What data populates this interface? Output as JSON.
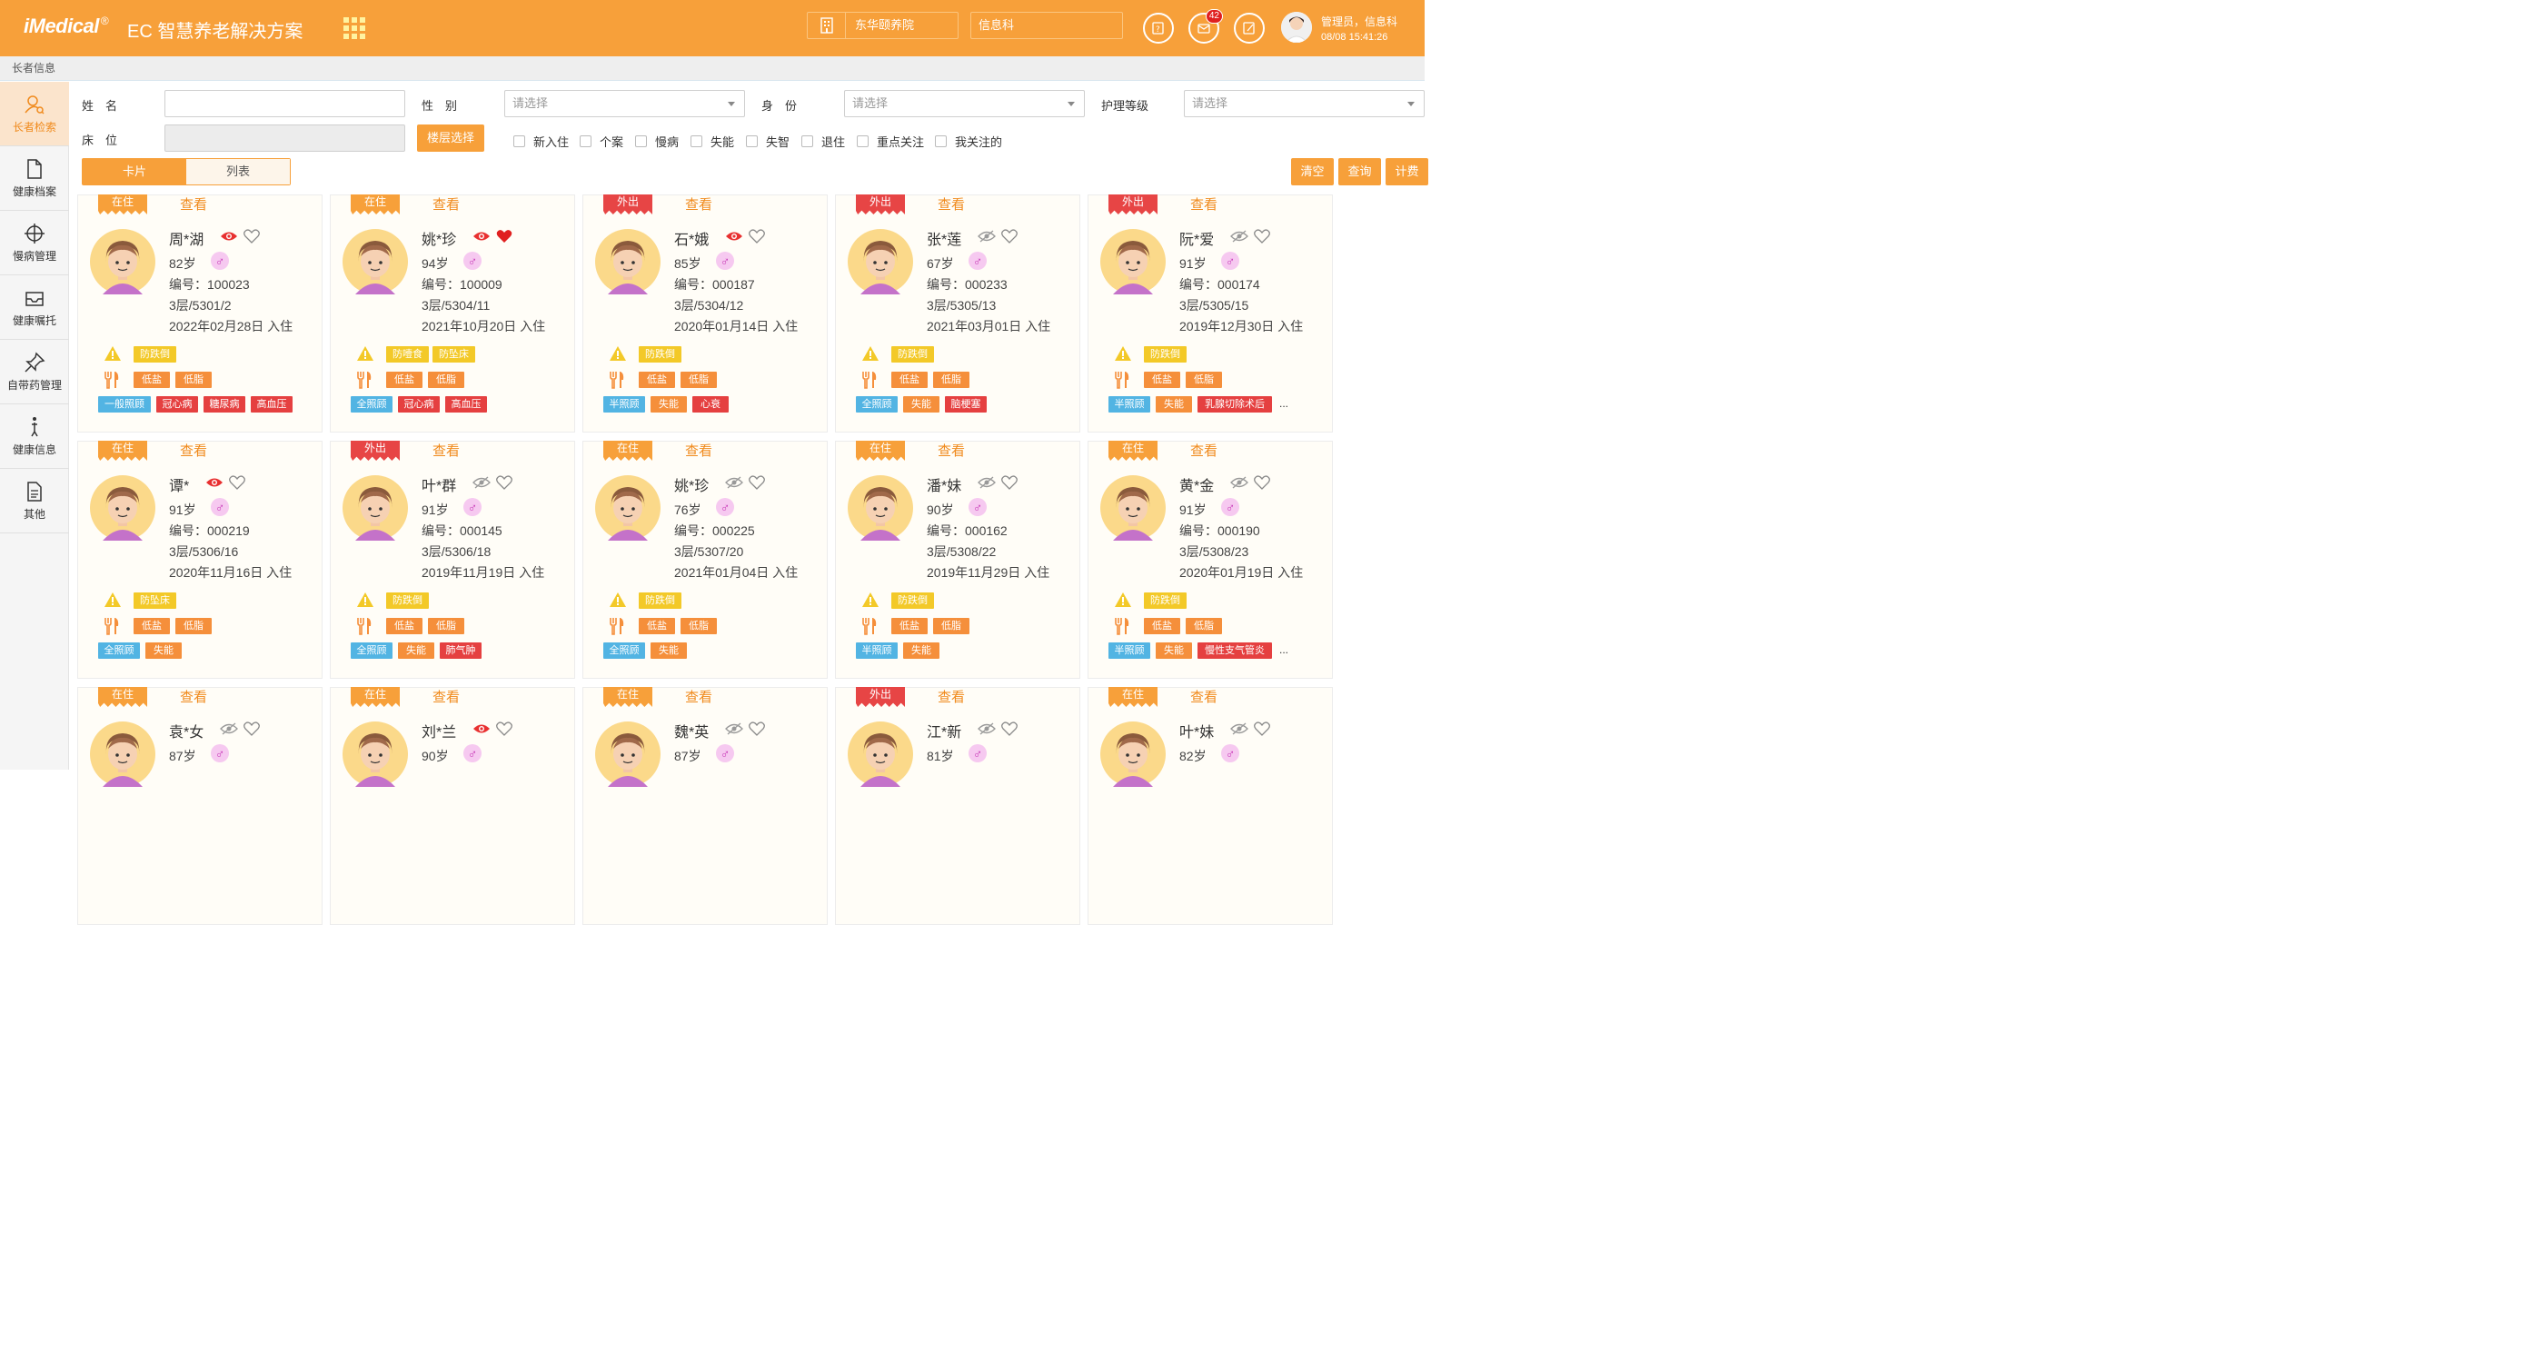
{
  "header": {
    "logo": "iMedical",
    "logo_reg": "®",
    "subtitle": "EC 智慧养老解决方案",
    "org": "东华颐养院",
    "dept": "信息科",
    "badge_count": "42",
    "user": "管理员，信息科",
    "datetime": "08/08 15:41:26"
  },
  "breadcrumb": "长者信息",
  "sidebar": {
    "items": [
      {
        "label": "长者检索",
        "icon": "user-search-icon"
      },
      {
        "label": "健康档案",
        "icon": "document-icon"
      },
      {
        "label": "慢病管理",
        "icon": "crosshair-icon"
      },
      {
        "label": "健康嘱托",
        "icon": "inbox-icon"
      },
      {
        "label": "自带药管理",
        "icon": "pin-icon"
      },
      {
        "label": "健康信息",
        "icon": "info-figure-icon"
      },
      {
        "label": "其他",
        "icon": "list-document-icon"
      }
    ]
  },
  "filters": {
    "name_label": "姓　名",
    "gender_label": "性　别",
    "identity_label": "身　份",
    "care_level_label": "护理等级",
    "bed_label": "床　位",
    "placeholder": "请选择",
    "floor_button": "楼层选择",
    "checkboxes": [
      "新入住",
      "个案",
      "慢病",
      "失能",
      "失智",
      "退住",
      "重点关注",
      "我关注的"
    ]
  },
  "view_toggle": {
    "card": "卡片",
    "list": "列表"
  },
  "actions": {
    "clear": "清空",
    "query": "查询",
    "fee": "计费"
  },
  "view_label": "查看",
  "colors": {
    "brand": "#f7a03a",
    "out": "#e74545",
    "tag_yellow": "#f3c928",
    "tag_orange": "#f58f3b",
    "tag_blue": "#52b4e3",
    "tag_red": "#e54040"
  },
  "residents": [
    {
      "status": "在住",
      "name": "周*湖",
      "eye": "open",
      "fav": false,
      "age": "82岁",
      "code": "编号：100023",
      "bed": "3层/5301/2",
      "date": "2022年02月28日 入住",
      "warn": [
        "防跌倒"
      ],
      "diet": [
        "低盐",
        "低脂"
      ],
      "tags": [
        [
          "一般照顾",
          "blue"
        ],
        [
          "冠心病",
          "red"
        ],
        [
          "糖尿病",
          "red"
        ],
        [
          "高血压",
          "red"
        ]
      ],
      "more": false
    },
    {
      "status": "在住",
      "name": "姚*珍",
      "eye": "open",
      "fav": true,
      "age": "94岁",
      "code": "编号：100009",
      "bed": "3层/5304/11",
      "date": "2021年10月20日 入住",
      "warn": [
        "防噎食",
        "防坠床"
      ],
      "diet": [
        "低盐",
        "低脂"
      ],
      "tags": [
        [
          "全照顾",
          "blue"
        ],
        [
          "冠心病",
          "red"
        ],
        [
          "高血压",
          "red"
        ]
      ],
      "more": false
    },
    {
      "status": "外出",
      "name": "石*娥",
      "eye": "open",
      "fav": false,
      "age": "85岁",
      "code": "编号：000187",
      "bed": "3层/5304/12",
      "date": "2020年01月14日 入住",
      "warn": [
        "防跌倒"
      ],
      "diet": [
        "低盐",
        "低脂"
      ],
      "tags": [
        [
          "半照顾",
          "blue"
        ],
        [
          "失能",
          "orange"
        ],
        [
          "心衰",
          "red"
        ]
      ],
      "more": false
    },
    {
      "status": "外出",
      "name": "张*莲",
      "eye": "closed",
      "fav": false,
      "age": "67岁",
      "code": "编号：000233",
      "bed": "3层/5305/13",
      "date": "2021年03月01日 入住",
      "warn": [
        "防跌倒"
      ],
      "diet": [
        "低盐",
        "低脂"
      ],
      "tags": [
        [
          "全照顾",
          "blue"
        ],
        [
          "失能",
          "orange"
        ],
        [
          "脑梗塞",
          "red"
        ]
      ],
      "more": false
    },
    {
      "status": "外出",
      "name": "阮*爱",
      "eye": "closed",
      "fav": false,
      "age": "91岁",
      "code": "编号：000174",
      "bed": "3层/5305/15",
      "date": "2019年12月30日 入住",
      "warn": [
        "防跌倒"
      ],
      "diet": [
        "低盐",
        "低脂"
      ],
      "tags": [
        [
          "半照顾",
          "blue"
        ],
        [
          "失能",
          "orange"
        ],
        [
          "乳腺切除术后",
          "red"
        ]
      ],
      "more": true
    },
    {
      "status": "在住",
      "name": "谭*",
      "eye": "open",
      "fav": false,
      "age": "91岁",
      "code": "编号：000219",
      "bed": "3层/5306/16",
      "date": "2020年11月16日 入住",
      "warn": [
        "防坠床"
      ],
      "diet": [
        "低盐",
        "低脂"
      ],
      "tags": [
        [
          "全照顾",
          "blue"
        ],
        [
          "失能",
          "orange"
        ]
      ],
      "more": false
    },
    {
      "status": "外出",
      "name": "叶*群",
      "eye": "closed",
      "fav": false,
      "age": "91岁",
      "code": "编号：000145",
      "bed": "3层/5306/18",
      "date": "2019年11月19日 入住",
      "warn": [
        "防跌倒"
      ],
      "diet": [
        "低盐",
        "低脂"
      ],
      "tags": [
        [
          "全照顾",
          "blue"
        ],
        [
          "失能",
          "orange"
        ],
        [
          "肺气肿",
          "red"
        ]
      ],
      "more": false
    },
    {
      "status": "在住",
      "name": "姚*珍",
      "eye": "closed",
      "fav": false,
      "age": "76岁",
      "code": "编号：000225",
      "bed": "3层/5307/20",
      "date": "2021年01月04日 入住",
      "warn": [
        "防跌倒"
      ],
      "diet": [
        "低盐",
        "低脂"
      ],
      "tags": [
        [
          "全照顾",
          "blue"
        ],
        [
          "失能",
          "orange"
        ]
      ],
      "more": false
    },
    {
      "status": "在住",
      "name": "潘*妹",
      "eye": "closed",
      "fav": false,
      "age": "90岁",
      "code": "编号：000162",
      "bed": "3层/5308/22",
      "date": "2019年11月29日 入住",
      "warn": [
        "防跌倒"
      ],
      "diet": [
        "低盐",
        "低脂"
      ],
      "tags": [
        [
          "半照顾",
          "blue"
        ],
        [
          "失能",
          "orange"
        ]
      ],
      "more": false
    },
    {
      "status": "在住",
      "name": "黄*金",
      "eye": "closed",
      "fav": false,
      "age": "91岁",
      "code": "编号：000190",
      "bed": "3层/5308/23",
      "date": "2020年01月19日 入住",
      "warn": [
        "防跌倒"
      ],
      "diet": [
        "低盐",
        "低脂"
      ],
      "tags": [
        [
          "半照顾",
          "blue"
        ],
        [
          "失能",
          "orange"
        ],
        [
          "慢性支气管炎",
          "red"
        ]
      ],
      "more": true
    },
    {
      "status": "在住",
      "name": "袁*女",
      "eye": "closed",
      "fav": false,
      "age": "87岁"
    },
    {
      "status": "在住",
      "name": "刘*兰",
      "eye": "open",
      "fav": false,
      "age": "90岁"
    },
    {
      "status": "在住",
      "name": "魏*英",
      "eye": "closed",
      "fav": false,
      "age": "87岁"
    },
    {
      "status": "外出",
      "name": "江*新",
      "eye": "closed",
      "fav": false,
      "age": "81岁"
    },
    {
      "status": "在住",
      "name": "叶*妹",
      "eye": "closed",
      "fav": false,
      "age": "82岁"
    }
  ]
}
